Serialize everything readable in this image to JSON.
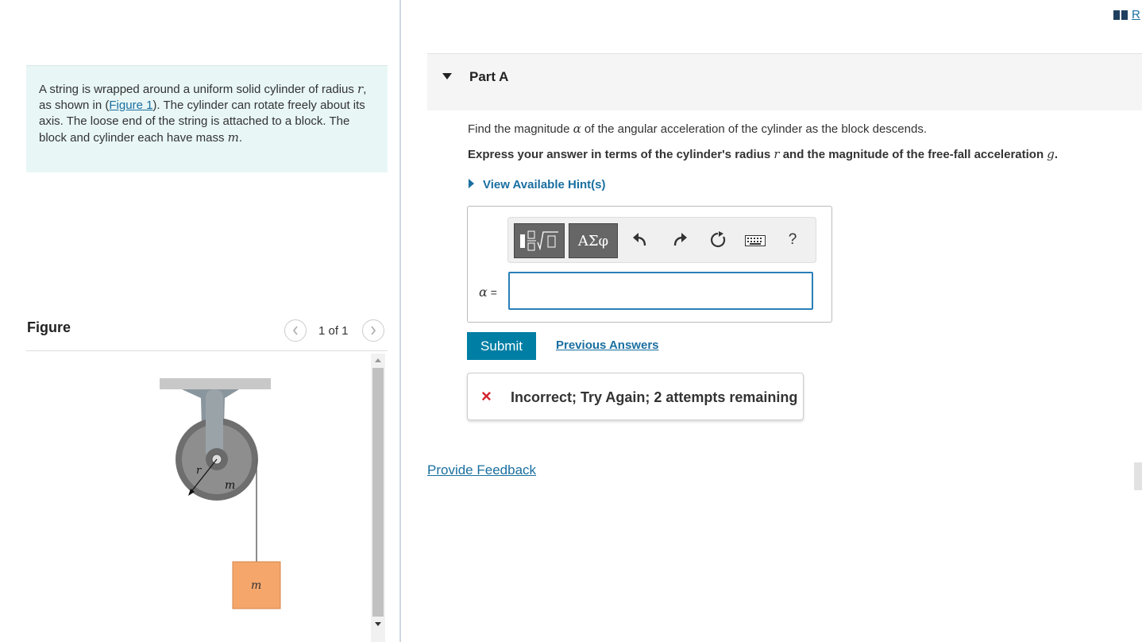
{
  "problem": {
    "text_before_r": "A string is wrapped around a uniform solid cylinder of radius ",
    "var_r": "r",
    "text_shown_in": ", as shown in ",
    "figure_link_open": "(",
    "figure_link": "Figure 1",
    "figure_link_close": ")",
    "text_after_link": ". The cylinder can rotate freely about its axis. The loose end of the string is attached to a block. The block and cylinder each have mass ",
    "var_m": "m",
    "text_end": "."
  },
  "figure": {
    "title": "Figure",
    "pager": "1 of 1",
    "prev_icon": "chevron-left-icon",
    "next_icon": "chevron-right-icon",
    "label_r": "r",
    "label_m_cylinder": "m",
    "label_m_block": "m",
    "colors": {
      "ceiling": "#c8c8c8",
      "cylinder": "#7a7a7a",
      "block": "#f4a66b"
    }
  },
  "part": {
    "title": "Part A",
    "question_pre": "Find the magnitude ",
    "question_alpha": "α",
    "question_post": " of the angular acceleration of the cylinder as the block descends.",
    "instr_pre": "Express your answer in terms of the cylinder's radius ",
    "instr_r": "r",
    "instr_mid": " and the magnitude of the free-fall acceleration ",
    "instr_g": "g",
    "instr_end": ".",
    "hint_link": "View Available Hint(s)"
  },
  "toolbar": {
    "templates_icon": "fraction-sqrt-icon",
    "greek_label": "ΑΣφ",
    "undo_icon": "undo-icon",
    "redo_icon": "redo-icon",
    "reset_icon": "reset-icon",
    "keyboard_icon": "keyboard-icon",
    "help_label": "?"
  },
  "answer": {
    "label_var": "α",
    "label_eq": " =",
    "value": ""
  },
  "actions": {
    "submit": "Submit",
    "previous_answers": "Previous Answers"
  },
  "feedback": {
    "icon": "×",
    "message": "Incorrect; Try Again; 2 attempts remaining",
    "provide_feedback": "Provide Feedback"
  },
  "top_right": {
    "icon": "book-icon",
    "label": "R"
  },
  "colors": {
    "accent": "#007ea4",
    "link": "#1a6fa0",
    "error": "#d2232a",
    "problem_bg": "#e8f6f6"
  }
}
